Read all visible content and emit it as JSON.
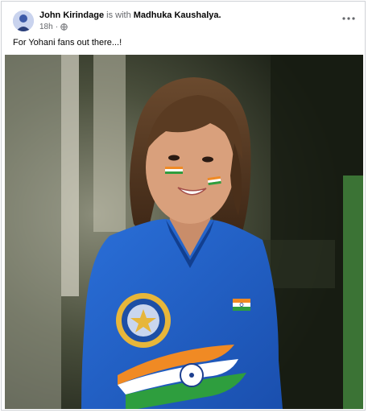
{
  "post": {
    "author": "John Kirindage",
    "with_text": "is with",
    "tagged": "Madhuka Kaushalya.",
    "time": "18h",
    "privacy_icon": "globe-icon",
    "more_icon": "more-options-icon",
    "caption": "For Yohani fans out there...!"
  },
  "colors": {
    "jersey": "#1f5fc4",
    "saffron": "#f08a24",
    "green": "#2e9e3e",
    "text_primary": "#050505",
    "text_secondary": "#65676b"
  }
}
